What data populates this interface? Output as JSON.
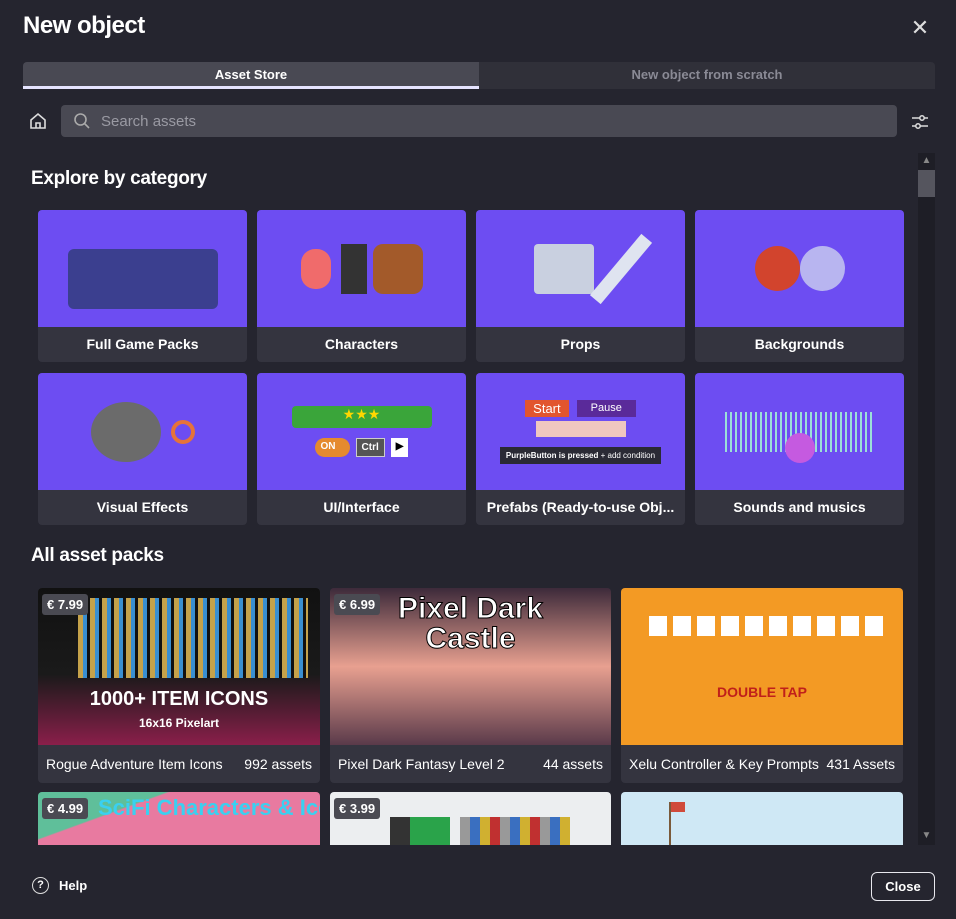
{
  "dialog": {
    "title": "New object"
  },
  "tabs": [
    {
      "label": "Asset Store",
      "active": true
    },
    {
      "label": "New object from scratch",
      "active": false
    }
  ],
  "search": {
    "placeholder": "Search assets",
    "value": ""
  },
  "categories": {
    "heading": "Explore by category",
    "items": [
      {
        "label": "Full Game Packs"
      },
      {
        "label": "Characters"
      },
      {
        "label": "Props"
      },
      {
        "label": "Backgrounds"
      },
      {
        "label": "Visual Effects"
      },
      {
        "label": "UI/Interface"
      },
      {
        "label": "Prefabs (Ready-to-use Obj..."
      },
      {
        "label": "Sounds and musics"
      }
    ]
  },
  "prefab_art": {
    "start": "Start",
    "pause": "Pause",
    "condition": "PurpleButton is pressed",
    "add_condition": "+ add condition"
  },
  "ui_art": {
    "on": "ON",
    "ctrl": "Ctrl"
  },
  "packs": {
    "heading": "All asset packs",
    "items": [
      {
        "name": "Rogue Adventure Item Icons",
        "count": "992 assets",
        "price": "€ 7.99",
        "art_text": "1000+ ITEM ICONS",
        "art_sub": "16x16 Pixelart"
      },
      {
        "name": "Pixel Dark Fantasy Level 2",
        "count": "44 assets",
        "price": "€ 6.99",
        "art_text": "Pixel Dark Castle"
      },
      {
        "name": "Xelu Controller & Key Prompts",
        "count": "431 Assets",
        "price": "",
        "art_text": "DOUBLE TAP"
      },
      {
        "name": "",
        "count": "",
        "price": "€ 4.99",
        "art_text": "SciFi Characters & Icons"
      },
      {
        "name": "",
        "count": "",
        "price": "€ 3.99"
      },
      {
        "name": "",
        "count": "",
        "price": ""
      }
    ]
  },
  "footer": {
    "help": "Help",
    "close": "Close"
  },
  "colors": {
    "background": "#25252f",
    "category_tile": "#6d4df2",
    "card": "#34343f"
  }
}
